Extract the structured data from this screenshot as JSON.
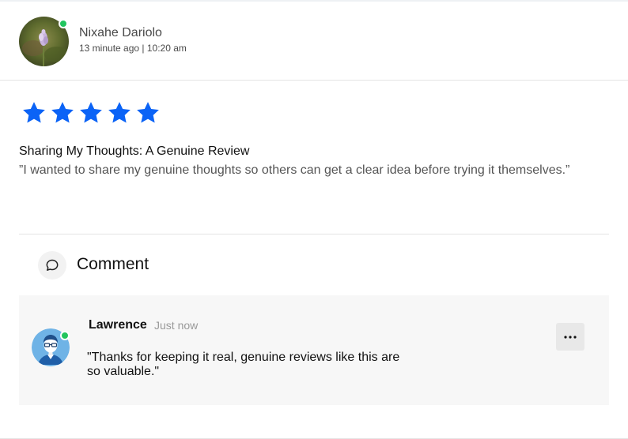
{
  "post": {
    "author_name": "Nixahe Dariolo",
    "meta": "13 minute ago | 10:20 am",
    "avatar_icon": "flower-photo-avatar",
    "online": true
  },
  "review": {
    "rating": 5,
    "rating_max": 5,
    "star_color": "#0b63f6",
    "title": "Sharing My Thoughts: A Genuine Review",
    "text": "”I wanted to share my genuine thoughts so others can get a clear idea before trying it themselves.”"
  },
  "comments_section": {
    "heading": "Comment",
    "icon": "speech-bubble-icon"
  },
  "comments": [
    {
      "name": "Lawrence",
      "time": "Just now",
      "text": "\"Thanks for keeping it real, genuine reviews like this are so valuable.\"",
      "avatar_icon": "user-glasses-avatar",
      "online": true,
      "menu_icon": "more-horizontal-icon"
    }
  ],
  "colors": {
    "online": "#22c55e",
    "accent": "#0b63f6",
    "card_bg": "#f7f7f7"
  }
}
